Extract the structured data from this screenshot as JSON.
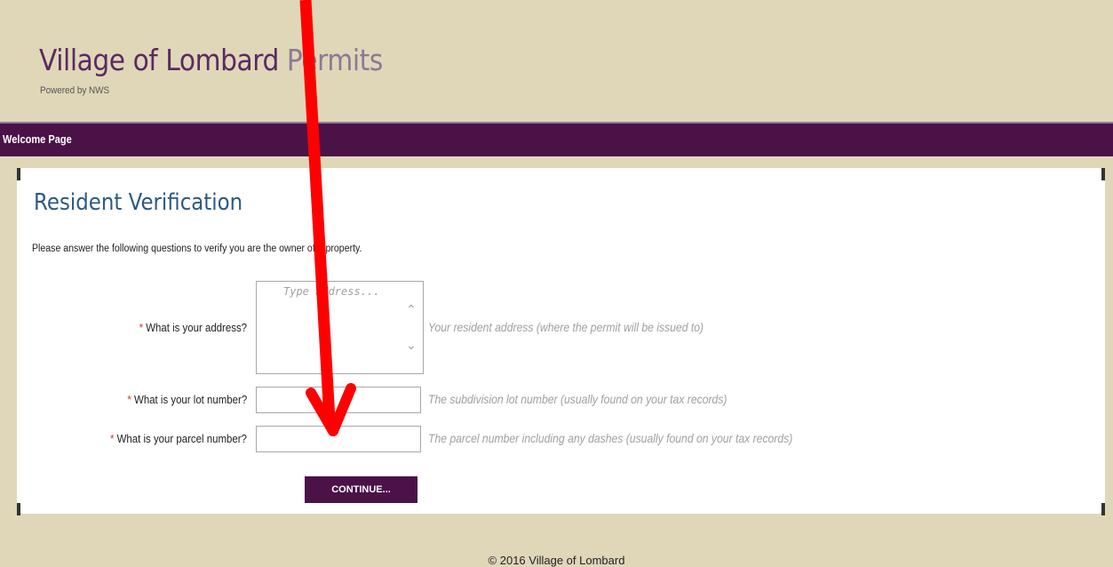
{
  "header": {
    "title_main": "Village of Lombard ",
    "title_accent": "Permits",
    "powered_by": "Powered by NWS"
  },
  "nav": {
    "label": "Welcome Page"
  },
  "form": {
    "heading": "Resident Verification",
    "intro": "Please answer the following questions to verify you are the owner of a property.",
    "required_mark": "*",
    "address": {
      "label": "What is your address?",
      "placeholder": "Type address...",
      "value": "",
      "hint": "Your resident address (where the permit will be issued to)"
    },
    "lot": {
      "label": "What is your lot number?",
      "value": "",
      "hint": "The subdivision lot number (usually found on your tax records)"
    },
    "parcel": {
      "label": "What is your parcel number?",
      "value": "",
      "hint": "The parcel number including any dashes (usually found on your tax records)"
    },
    "continue_label": "CONTINUE..."
  },
  "footer": {
    "copyright": "© 2016 Village of Lombard"
  },
  "icons": {
    "scroll_up": "chevron-up-icon",
    "scroll_down": "chevron-down-icon",
    "annotation": "red-arrow-annotation"
  },
  "colors": {
    "accent": "#4b1248",
    "background": "#e0d7b8",
    "heading": "#2c5a84",
    "annotation": "#ff0000"
  }
}
